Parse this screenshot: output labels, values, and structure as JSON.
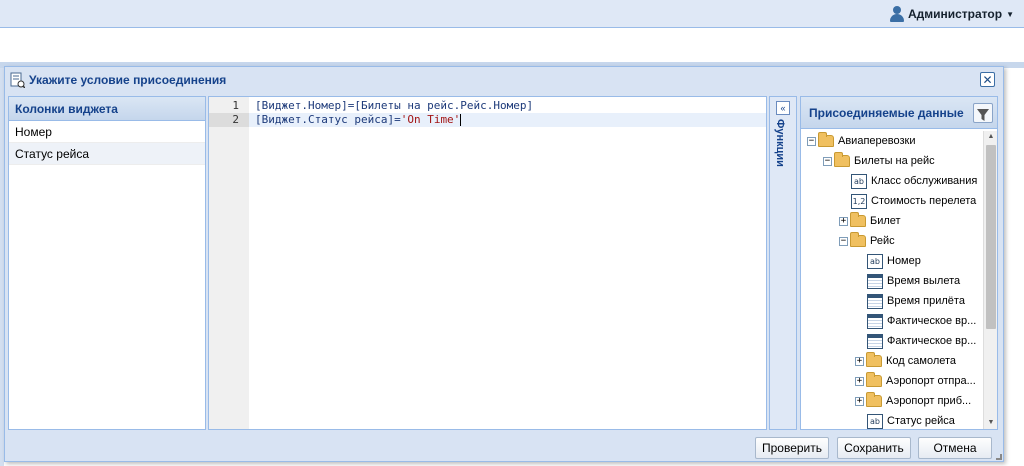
{
  "topbar": {
    "user_name": "Администратор"
  },
  "dialog": {
    "title": "Укажите условие присоединения",
    "close_glyph": "✕"
  },
  "columns": {
    "header": "Колонки виджета",
    "items": [
      "Номер",
      "Статус рейса"
    ]
  },
  "editor": {
    "lines": [
      {
        "number": "1",
        "code": "[Виджет.Номер]=[Билеты на рейс.Рейс.Номер]",
        "string": ""
      },
      {
        "number": "2",
        "code": "[Виджет.Статус рейса]=",
        "string": "'On Time'"
      }
    ]
  },
  "functions": {
    "label": "Функции",
    "toggle_glyph": "«"
  },
  "joined": {
    "header": "Присоединяемые данные",
    "tree": [
      {
        "label": "Авиаперевозки",
        "type": "folder",
        "expander": "−"
      },
      {
        "label": "Билеты на рейс",
        "type": "folder",
        "expander": "−"
      },
      {
        "label": "Класс обслуживания",
        "type": "text",
        "icon_text": "ab"
      },
      {
        "label": "Стоимость перелета",
        "type": "number",
        "icon_text": "1,2"
      },
      {
        "label": "Билет",
        "type": "folder",
        "expander": "+"
      },
      {
        "label": "Рейс",
        "type": "folder",
        "expander": "−"
      },
      {
        "label": "Номер",
        "type": "text",
        "icon_text": "ab"
      },
      {
        "label": "Время вылета",
        "type": "date",
        "icon_text": ""
      },
      {
        "label": "Время прилёта",
        "type": "date",
        "icon_text": ""
      },
      {
        "label": "Фактическое вр...",
        "type": "date",
        "icon_text": ""
      },
      {
        "label": "Фактическое вр...",
        "type": "date",
        "icon_text": ""
      },
      {
        "label": "Код самолета",
        "type": "folder",
        "expander": "+"
      },
      {
        "label": "Аэропорт отпра...",
        "type": "folder",
        "expander": "+"
      },
      {
        "label": "Аэропорт приб...",
        "type": "folder",
        "expander": "+"
      },
      {
        "label": "Статус рейса",
        "type": "text",
        "icon_text": "ab"
      }
    ]
  },
  "buttons": {
    "check": "Проверить",
    "save": "Сохранить",
    "cancel": "Отмена"
  }
}
